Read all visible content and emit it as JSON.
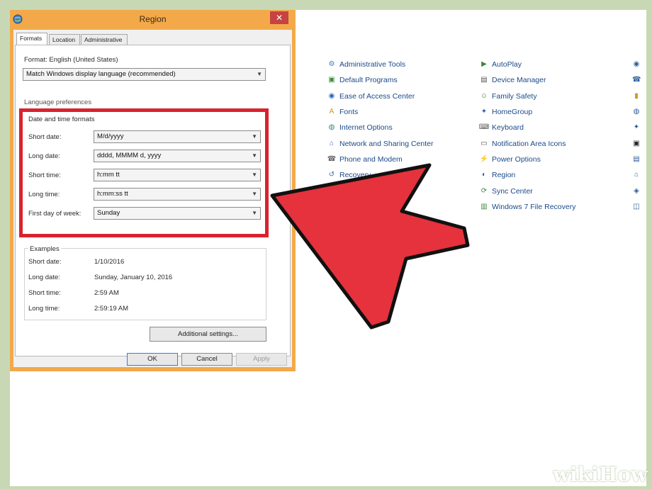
{
  "dialog": {
    "title": "Region",
    "close": "✕",
    "tabs": [
      "Formats",
      "Location",
      "Administrative"
    ],
    "format_label": "Format: English (United States)",
    "format_value": "Match Windows display language (recommended)",
    "language_prefs_label": "Language preferences",
    "datetime_group_label": "Date and time formats",
    "fields": [
      {
        "label": "Short date:",
        "value": "M/d/yyyy"
      },
      {
        "label": "Long date:",
        "value": "dddd, MMMM d, yyyy"
      },
      {
        "label": "Short time:",
        "value": "h:mm tt"
      },
      {
        "label": "Long time:",
        "value": "h:mm:ss tt"
      },
      {
        "label": "First day of week:",
        "value": "Sunday"
      }
    ],
    "examples_label": "Examples",
    "examples": [
      {
        "label": "Short date:",
        "value": "1/10/2016"
      },
      {
        "label": "Long date:",
        "value": "Sunday, January 10, 2016"
      },
      {
        "label": "Short time:",
        "value": "2:59 AM"
      },
      {
        "label": "Long time:",
        "value": "2:59:19 AM"
      }
    ],
    "additional_settings": "Additional settings...",
    "ok": "OK",
    "cancel": "Cancel",
    "apply": "Apply"
  },
  "control_panel": {
    "col1": [
      {
        "label": "Administrative Tools",
        "icon": "admin-tools-icon"
      },
      {
        "label": "Default Programs",
        "icon": "default-programs-icon"
      },
      {
        "label": "Ease of Access Center",
        "icon": "ease-of-access-icon"
      },
      {
        "label": "Fonts",
        "icon": "fonts-icon"
      },
      {
        "label": "Internet Options",
        "icon": "internet-options-icon"
      },
      {
        "label": "Network and Sharing Center",
        "icon": "network-icon"
      },
      {
        "label": "Phone and Modem",
        "icon": "phone-icon"
      },
      {
        "label": "Recovery",
        "icon": "recovery-icon"
      }
    ],
    "col2": [
      {
        "label": "AutoPlay",
        "icon": "autoplay-icon"
      },
      {
        "label": "Device Manager",
        "icon": "device-manager-icon"
      },
      {
        "label": "Family Safety",
        "icon": "family-safety-icon"
      },
      {
        "label": "HomeGroup",
        "icon": "homegroup-icon"
      },
      {
        "label": "Keyboard",
        "icon": "keyboard-icon"
      },
      {
        "label": "Notification Area Icons",
        "icon": "notification-icon"
      },
      {
        "label": "Power Options",
        "icon": "power-icon"
      },
      {
        "label": "Region",
        "icon": "region-icon"
      },
      {
        "label": "Sync Center",
        "icon": "sync-icon"
      },
      {
        "label": "Windows 7 File Recovery",
        "icon": "file-recovery-icon"
      }
    ]
  },
  "watermark": "wikiHow",
  "colors": {
    "accent_red": "#d9222e",
    "title_bar": "#f3a94a",
    "link_blue": "#1b4a8a"
  }
}
